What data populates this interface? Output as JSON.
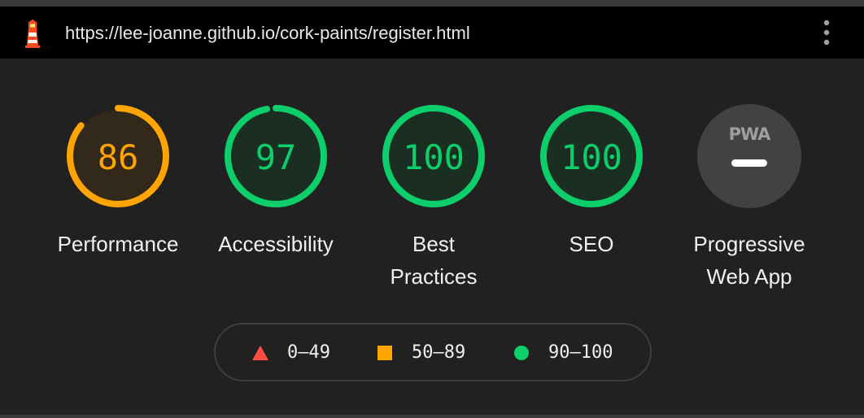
{
  "topbar": {
    "url": "https://lee-joanne.github.io/cork-paints/register.html",
    "logo_icon": "lighthouse-logo-icon",
    "menu_icon": "vertical-dots-menu-icon"
  },
  "gauges": [
    {
      "score": 86,
      "score_text": "86",
      "label_line1": "Performance",
      "label_line2": "",
      "color": "#ffa400",
      "fill": "#33291a"
    },
    {
      "score": 97,
      "score_text": "97",
      "label_line1": "Accessibility",
      "label_line2": "",
      "color": "#0cce6b",
      "fill": "#1a2e22"
    },
    {
      "score": 100,
      "score_text": "100",
      "label_line1": "Best",
      "label_line2": "Practices",
      "color": "#0cce6b",
      "fill": "#1a2e22"
    },
    {
      "score": 100,
      "score_text": "100",
      "label_line1": "SEO",
      "label_line2": "",
      "color": "#0cce6b",
      "fill": "#1a2e22"
    }
  ],
  "pwa": {
    "badge_text": "PWA",
    "label_line1": "Progressive",
    "label_line2": "Web App",
    "color": "#424242"
  },
  "legend": [
    {
      "range": "0–49",
      "shape": "triangle",
      "color": "#ff4e42"
    },
    {
      "range": "50–89",
      "shape": "square",
      "color": "#ffa400"
    },
    {
      "range": "90–100",
      "shape": "circle",
      "color": "#0cce6b"
    }
  ]
}
